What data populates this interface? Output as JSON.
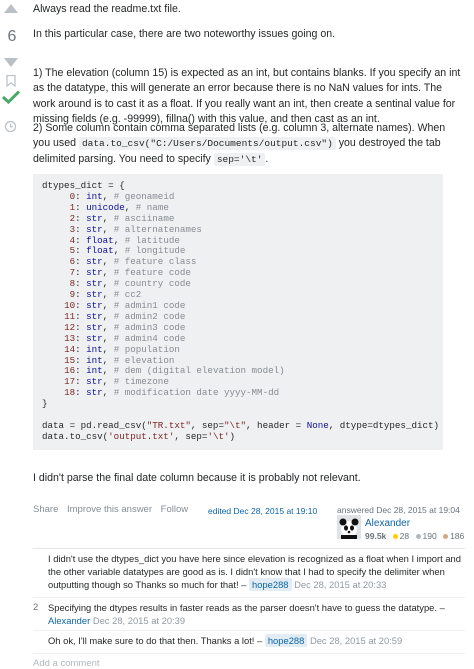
{
  "vote": {
    "count": "6"
  },
  "answer": {
    "p0": "Always read the readme.txt file.",
    "p1": "In this particular case, there are two noteworthy issues going on.",
    "p2": "1) The elevation (column 15) is expected as an int, but contains blanks. If you specify an int as the datatype, this will generate an error because there is no NaN values for ints. The work around is to cast it as a float. If you really want an int, then create a sentinal value for missing fields (e.g. -99999), fillna() with this value, and then cast as an int.",
    "p3_a": "2) Some column contain comma separated lists (e.g. column 3, alternate names). When you used ",
    "p3_code": "data.to_csv(\"C:/Users/Documents/output.csv\")",
    "p3_b": " you destroyed the tab delimited parsing. You need to specify ",
    "p3_code2": "sep='\\t'",
    "p3_c": ".",
    "code": {
      "open": "dtypes_dict = {",
      "rows": [
        {
          "n": "0",
          "t": "int",
          "c": "# geonameid"
        },
        {
          "n": "1",
          "t": "unicode",
          "c": "# name"
        },
        {
          "n": "2",
          "t": "str",
          "c": "# asciiname"
        },
        {
          "n": "3",
          "t": "str",
          "c": "# alternatenames"
        },
        {
          "n": "4",
          "t": "float",
          "c": "# latitude"
        },
        {
          "n": "5",
          "t": "float",
          "c": "# longitude"
        },
        {
          "n": "6",
          "t": "str",
          "c": "# feature class"
        },
        {
          "n": "7",
          "t": "str",
          "c": "# feature code"
        },
        {
          "n": "8",
          "t": "str",
          "c": "# country code"
        },
        {
          "n": "9",
          "t": "str",
          "c": "# cc2"
        },
        {
          "n": "10",
          "t": "str",
          "c": "# admin1 code"
        },
        {
          "n": "11",
          "t": "str",
          "c": "# admin2 code"
        },
        {
          "n": "12",
          "t": "str",
          "c": "# admin3 code"
        },
        {
          "n": "13",
          "t": "str",
          "c": "# admin4 code"
        },
        {
          "n": "14",
          "t": "int",
          "c": "# population"
        },
        {
          "n": "15",
          "t": "int",
          "c": "# elevation"
        },
        {
          "n": "16",
          "t": "int",
          "c": "# dem (digital elevation model)"
        },
        {
          "n": "17",
          "t": "str",
          "c": "# timezone"
        },
        {
          "n": "18",
          "t": "str",
          "c": "# modification date yyyy-MM-dd"
        }
      ],
      "close": "}",
      "line1_a": "data = pd.read_csv(",
      "line1_s1": "\"TR.txt\"",
      "line1_b": ", sep=",
      "line1_s2": "\"\\t\"",
      "line1_c": ", header = ",
      "line1_kw": "None",
      "line1_d": ", dtype=dtypes_dict)",
      "line2_a": "data.to_csv(",
      "line2_s1": "'output.txt'",
      "line2_b": ", sep=",
      "line2_s2": "'\\t'",
      "line2_c": ")"
    },
    "p4": "I didn't parse the final date column because it is probably not relevant."
  },
  "menu": {
    "share": "Share",
    "improve": "Improve this answer",
    "follow": "Follow"
  },
  "edited": "edited Dec 28, 2015 at 19:10",
  "signature": {
    "asked": "answered Dec 28, 2015 at 19:04",
    "name": "Alexander",
    "rep": "99.5k",
    "gold": "28",
    "silver": "190",
    "bronze": "186",
    "gold_color": "#ffcc01",
    "silver_color": "#b4b8bc",
    "bronze_color": "#d1a684"
  },
  "comments": [
    {
      "score": "",
      "text": "I didn't use the dtypes_dict you have here since elevation is recognized as a float when I import and the other variable datatypes are good as is. I didn't know that I had to specify the delimiter when outputting though so Thanks so much for that! –",
      "user": "hope288",
      "date": "Dec 28, 2015 at 20:33"
    },
    {
      "score": "2",
      "text": "Specifying the dtypes results in faster reads as the parser doesn't have to guess the datatype. –",
      "user": "Alexander",
      "date": "Dec 28, 2015 at 20:39"
    },
    {
      "score": "",
      "text": "Oh ok, I'll make sure to do that then. Thanks a lot! –",
      "user": "hope288",
      "date": "Dec 28, 2015 at 20:59"
    }
  ],
  "add_comment": "Add a comment"
}
